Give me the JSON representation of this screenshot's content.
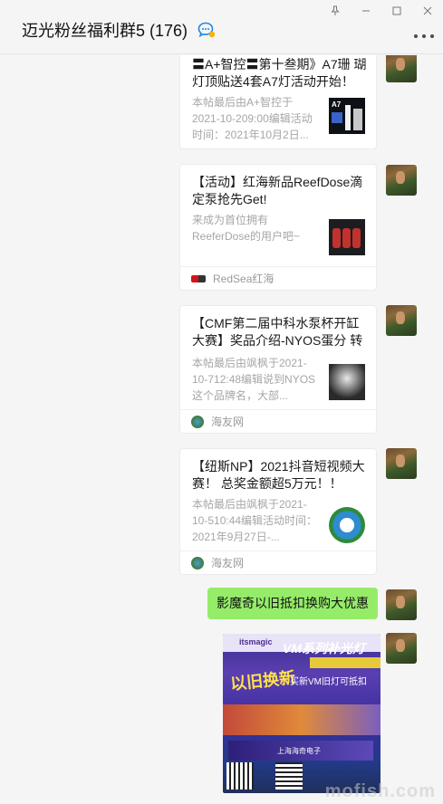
{
  "window": {
    "title": "迈光粉丝福利群5 (176)"
  },
  "messages": {
    "card1": {
      "title": "〓A+智控〓第十叁期》A7珊 瑚灯顶贴送4套A7灯活动开始！",
      "desc": "本帖最后由A+智控于2021-10-209:00编辑活动时间：2021年10月2日...",
      "thumb_text": "A7"
    },
    "card2": {
      "title": "【活动】红海新品ReefDose滴定泵抢先Get!",
      "desc": "来成为首位拥有ReeferDose的用户吧~",
      "source": "RedSea红海"
    },
    "card3": {
      "title": "【CMF第二届中科水泵杯开缸大赛】奖品介绍-NYOS蛋分 转发...",
      "desc": "本帖最后由飒枫于2021-10-712:48编辑说到NYOS这个品牌名，大部...",
      "source": "海友网"
    },
    "card4": {
      "title": "【纽斯NP】2021抖音短视频大赛！ 总奖金额超5万元！！",
      "desc": "本帖最后由飒枫于2021-10-510:44编辑活动时间：2021年9月27日-...",
      "source": "海友网"
    },
    "bubble": {
      "text": "影魔奇以旧抵扣换购大优惠"
    },
    "poster": {
      "brand": "itsmagic",
      "headline": "VM系列补光灯",
      "swap": "以旧换新",
      "offer": "买新VM旧灯可抵扣",
      "footer": "上海海奇电子"
    },
    "watermark": "mofish.com"
  }
}
